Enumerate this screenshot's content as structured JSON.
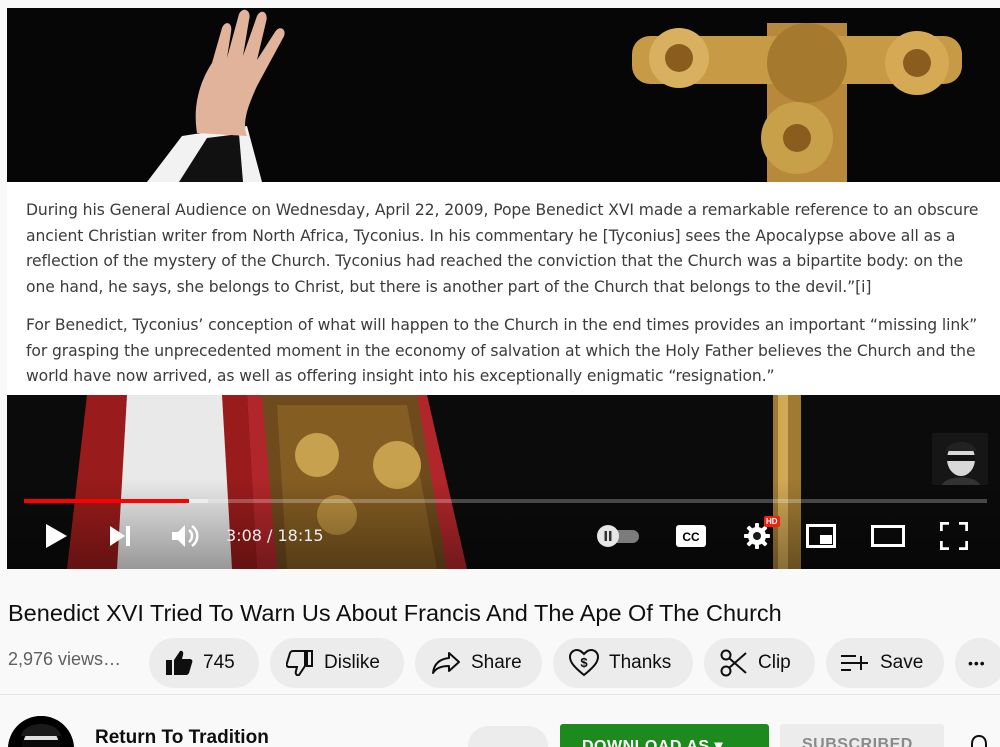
{
  "player": {
    "overlay_paragraphs": [
      "During his General Audience on Wednesday, April 22, 2009, Pope Benedict XVI made a remarkable reference to an obscure ancient Christian writer from North Africa, Tyconius. In his commentary he [Tyconius] sees the Apocalypse above all as a reflection of the mystery of the Church. Tyconius had reached the conviction that the Church was a bipartite body: on the one hand, he says, she belongs to Christ, but there is another part of the Church that belongs to the devil.”[i]",
      "For Benedict, Tyconius’ conception of what will happen to the Church in the end times provides an important “missing link” for grasping the unprecedented moment in the economy of salvation at which the Holy Father believes the Church and the world have now arrived, as well as offering insight into his exceptionally enigmatic “resignation.”"
    ],
    "time_display": "3:08 / 18:15",
    "progress_played": 0.171,
    "progress_buffered": 0.191,
    "hd_badge": "HD",
    "accent_color": "#ff0000"
  },
  "video": {
    "title": "Benedict XVI Tried To Warn Us About Francis And The Ape Of The Church",
    "views": "2,976 views…"
  },
  "actions": {
    "like_count": "745",
    "dislike_label": "Dislike",
    "share_label": "Share",
    "thanks_label": "Thanks",
    "clip_label": "Clip",
    "save_label": "Save",
    "more_label": "•••"
  },
  "channel": {
    "name": "Return To Tradition",
    "download_label": "DOWNLOAD AS ▾",
    "subscribed_label": "SUBSCRIBED",
    "download_color": "#1d8a1d"
  }
}
